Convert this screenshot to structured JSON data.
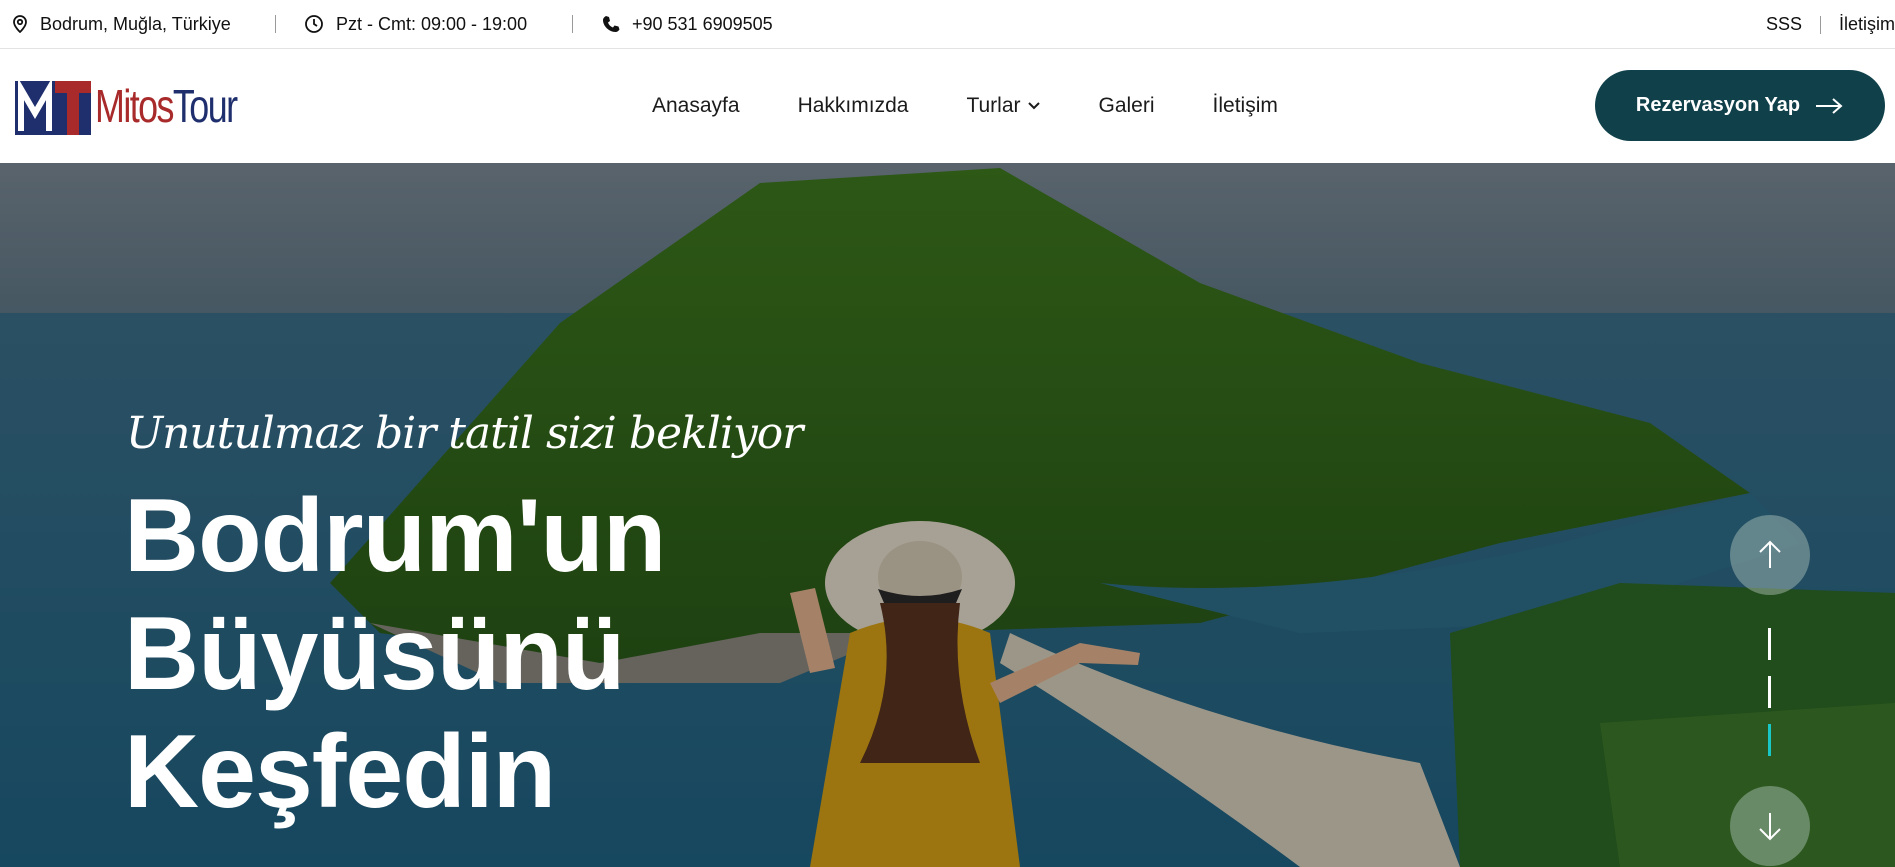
{
  "topbar": {
    "location": "Bodrum, Muğla, Türkiye",
    "hours": "Pzt - Cmt: 09:00 - 19:00",
    "phone": "+90 531 6909505",
    "faq": "SSS",
    "contact": "İletişim"
  },
  "logo": {
    "part1": "Mitos",
    "part2": "Tour"
  },
  "nav": {
    "items": [
      {
        "label": "Anasayfa"
      },
      {
        "label": "Hakkımızda"
      },
      {
        "label": "Turlar"
      },
      {
        "label": "Galeri"
      },
      {
        "label": "İletişim"
      }
    ]
  },
  "cta": {
    "label": "Rezervasyon Yap"
  },
  "hero": {
    "subtitle": "Unutulmaz bir tatil sizi bekliyor",
    "title_lines": [
      "Bodrum'un",
      "Büyüsünü",
      "Keşfedin"
    ]
  },
  "colors": {
    "accent": "#10404a",
    "active_dot": "#19c7c7",
    "logo_red": "#a82a2a",
    "logo_blue": "#1f2f6e"
  },
  "icons": [
    "location-pin-icon",
    "clock-icon",
    "phone-icon",
    "chevron-down-icon",
    "arrow-right-icon",
    "arrow-up-icon",
    "arrow-down-icon"
  ]
}
